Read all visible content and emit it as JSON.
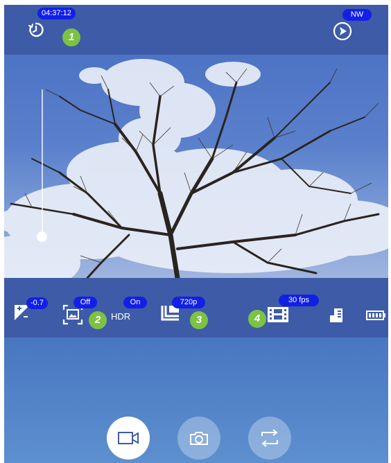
{
  "top": {
    "timer_value": "04:37:12",
    "compass_value": "NW",
    "marker_1": "1"
  },
  "controls": {
    "exposure_value": "-0.7",
    "scene_value": "Off",
    "hdr_value": "On",
    "hdr_label": "HDR",
    "resolution_value": "720p",
    "fps_value": "30 fps",
    "marker_2": "2",
    "marker_3": "3",
    "marker_4": "4"
  },
  "exposure_slider": {
    "level": 0.29
  },
  "icons": {
    "timer": "timer-icon",
    "compass": "compass-icon",
    "exposure": "exposure-icon",
    "scene": "scene-frame-icon",
    "resolution": "resolution-icon",
    "fps": "film-icon",
    "storage": "sd-card-icon",
    "battery": "battery-icon",
    "video": "video-camera-icon",
    "photo": "camera-icon",
    "switch": "switch-camera-icon"
  },
  "colors": {
    "badge": "#1220e6",
    "marker": "#7cc243",
    "bar": "#3e5ba7"
  }
}
